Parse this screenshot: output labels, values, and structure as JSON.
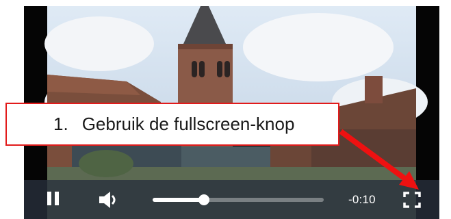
{
  "player": {
    "controls": {
      "play_state": "pause",
      "pause_icon": "pause-icon",
      "volume_icon": "speaker-volume-icon",
      "fullscreen_icon": "fullscreen-icon",
      "progress": 0.3,
      "time_remaining": "-0:10"
    }
  },
  "callout": {
    "number": "1.",
    "text": "Gebruik de fullscreen-knop",
    "border_color": "#e21b1b",
    "arrow_color": "#ee1111"
  }
}
